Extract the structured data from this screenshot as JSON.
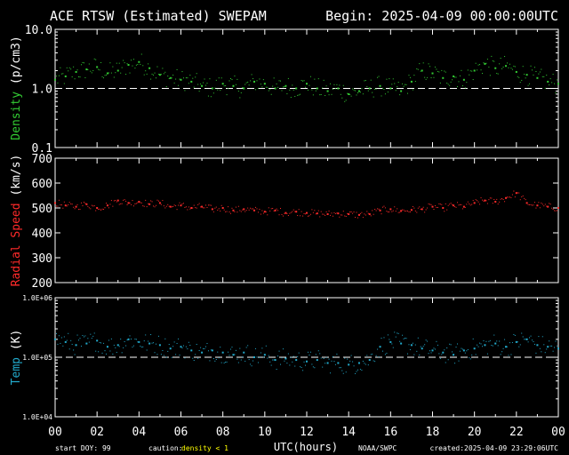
{
  "header": {
    "title": "ACE RTSW (Estimated) SWEPAM",
    "begin": "Begin: 2025-04-09 00:00:00UTC"
  },
  "footer": {
    "start_doy": "start DOY:  99",
    "caution_label": "caution:",
    "caution_value": "density < 1",
    "xlabel": "UTC(hours)",
    "source": "NOAA/SWPC",
    "created": "created:2025-04-09 23:29:06UTC"
  },
  "colors": {
    "background": "#000000",
    "axes": "#ffffff",
    "density": "#33cc33",
    "speed": "#ff2a2a",
    "temp": "#22aacc",
    "caution": "#ffff00"
  },
  "chart_data": [
    {
      "type": "scatter",
      "panel": "density",
      "ylabel": "Density (p/cm3)",
      "ylog": true,
      "ylim": [
        0.1,
        10.0
      ],
      "ytick_labels": [
        "10.0",
        "1.0",
        "0.1"
      ],
      "ytick_values": [
        10.0,
        1.0,
        0.1
      ],
      "reference_line": 1.0,
      "xlim": [
        0,
        24
      ],
      "x": [
        0,
        0.5,
        1,
        1.5,
        2,
        2.5,
        3,
        3.5,
        4,
        4.5,
        5,
        5.5,
        6,
        6.5,
        7,
        7.5,
        8,
        8.5,
        9,
        9.5,
        10,
        10.5,
        11,
        11.5,
        12,
        12.5,
        13,
        13.5,
        14,
        14.5,
        15,
        15.5,
        16,
        16.5,
        17,
        17.5,
        18,
        18.5,
        19,
        19.5,
        20,
        20.5,
        21,
        21.5,
        22,
        22.5,
        23,
        23.5,
        24
      ],
      "y": [
        1.4,
        1.6,
        1.9,
        2.1,
        2.3,
        1.8,
        2.0,
        2.5,
        2.8,
        2.2,
        1.7,
        1.5,
        1.4,
        1.3,
        1.1,
        1.0,
        1.2,
        1.1,
        1.0,
        1.3,
        1.2,
        1.0,
        1.1,
        1.0,
        1.2,
        1.0,
        0.9,
        1.0,
        0.8,
        0.9,
        1.0,
        1.1,
        1.0,
        0.9,
        1.3,
        2.0,
        1.8,
        1.5,
        1.6,
        1.4,
        2.0,
        2.6,
        2.2,
        2.4,
        1.9,
        1.7,
        1.5,
        1.3,
        1.2
      ]
    },
    {
      "type": "scatter",
      "panel": "speed",
      "ylabel": "Radial Speed (km/s)",
      "ylim": [
        200,
        700
      ],
      "ytick_labels": [
        "700",
        "600",
        "500",
        "400",
        "300",
        "200"
      ],
      "ytick_values": [
        700,
        600,
        500,
        400,
        300,
        200
      ],
      "xlim": [
        0,
        24
      ],
      "x": [
        0,
        0.5,
        1,
        1.5,
        2,
        2.5,
        3,
        3.5,
        4,
        4.5,
        5,
        5.5,
        6,
        6.5,
        7,
        7.5,
        8,
        8.5,
        9,
        9.5,
        10,
        10.5,
        11,
        11.5,
        12,
        12.5,
        13,
        13.5,
        14,
        14.5,
        15,
        15.5,
        16,
        16.5,
        17,
        17.5,
        18,
        18.5,
        19,
        19.5,
        20,
        20.5,
        21,
        21.5,
        22,
        22.5,
        23,
        23.5,
        24
      ],
      "y": [
        520,
        510,
        505,
        515,
        500,
        510,
        530,
        520,
        525,
        515,
        520,
        505,
        510,
        500,
        505,
        495,
        500,
        490,
        495,
        490,
        485,
        490,
        480,
        485,
        480,
        478,
        475,
        478,
        475,
        472,
        475,
        490,
        495,
        488,
        492,
        495,
        505,
        500,
        510,
        505,
        520,
        530,
        525,
        540,
        560,
        520,
        510,
        505,
        500
      ]
    },
    {
      "type": "scatter",
      "panel": "temp",
      "ylabel": "Temp (K)",
      "ylog": true,
      "ylim": [
        10000,
        1000000
      ],
      "ytick_labels": [
        "1.0E+06",
        "1.0E+05",
        "1.0E+04"
      ],
      "ytick_values": [
        1000000,
        100000,
        10000
      ],
      "reference_line": 100000,
      "xlim": [
        0,
        24
      ],
      "x": [
        0,
        0.5,
        1,
        1.5,
        2,
        2.5,
        3,
        3.5,
        4,
        4.5,
        5,
        5.5,
        6,
        6.5,
        7,
        7.5,
        8,
        8.5,
        9,
        9.5,
        10,
        10.5,
        11,
        11.5,
        12,
        12.5,
        13,
        13.5,
        14,
        14.5,
        15,
        15.5,
        16,
        16.5,
        17,
        17.5,
        18,
        18.5,
        19,
        19.5,
        20,
        20.5,
        21,
        21.5,
        22,
        22.5,
        23,
        23.5,
        24
      ],
      "y": [
        200000,
        180000,
        160000,
        170000,
        190000,
        150000,
        160000,
        200000,
        180000,
        170000,
        160000,
        140000,
        150000,
        130000,
        120000,
        130000,
        120000,
        110000,
        120000,
        100000,
        110000,
        90000,
        95000,
        90000,
        85000,
        90000,
        80000,
        80000,
        75000,
        80000,
        90000,
        150000,
        180000,
        170000,
        160000,
        140000,
        130000,
        120000,
        110000,
        130000,
        140000,
        160000,
        170000,
        150000,
        180000,
        200000,
        160000,
        150000,
        140000
      ]
    }
  ],
  "xtick_labels": [
    "00",
    "02",
    "04",
    "06",
    "08",
    "10",
    "12",
    "14",
    "16",
    "18",
    "20",
    "22",
    "00"
  ]
}
